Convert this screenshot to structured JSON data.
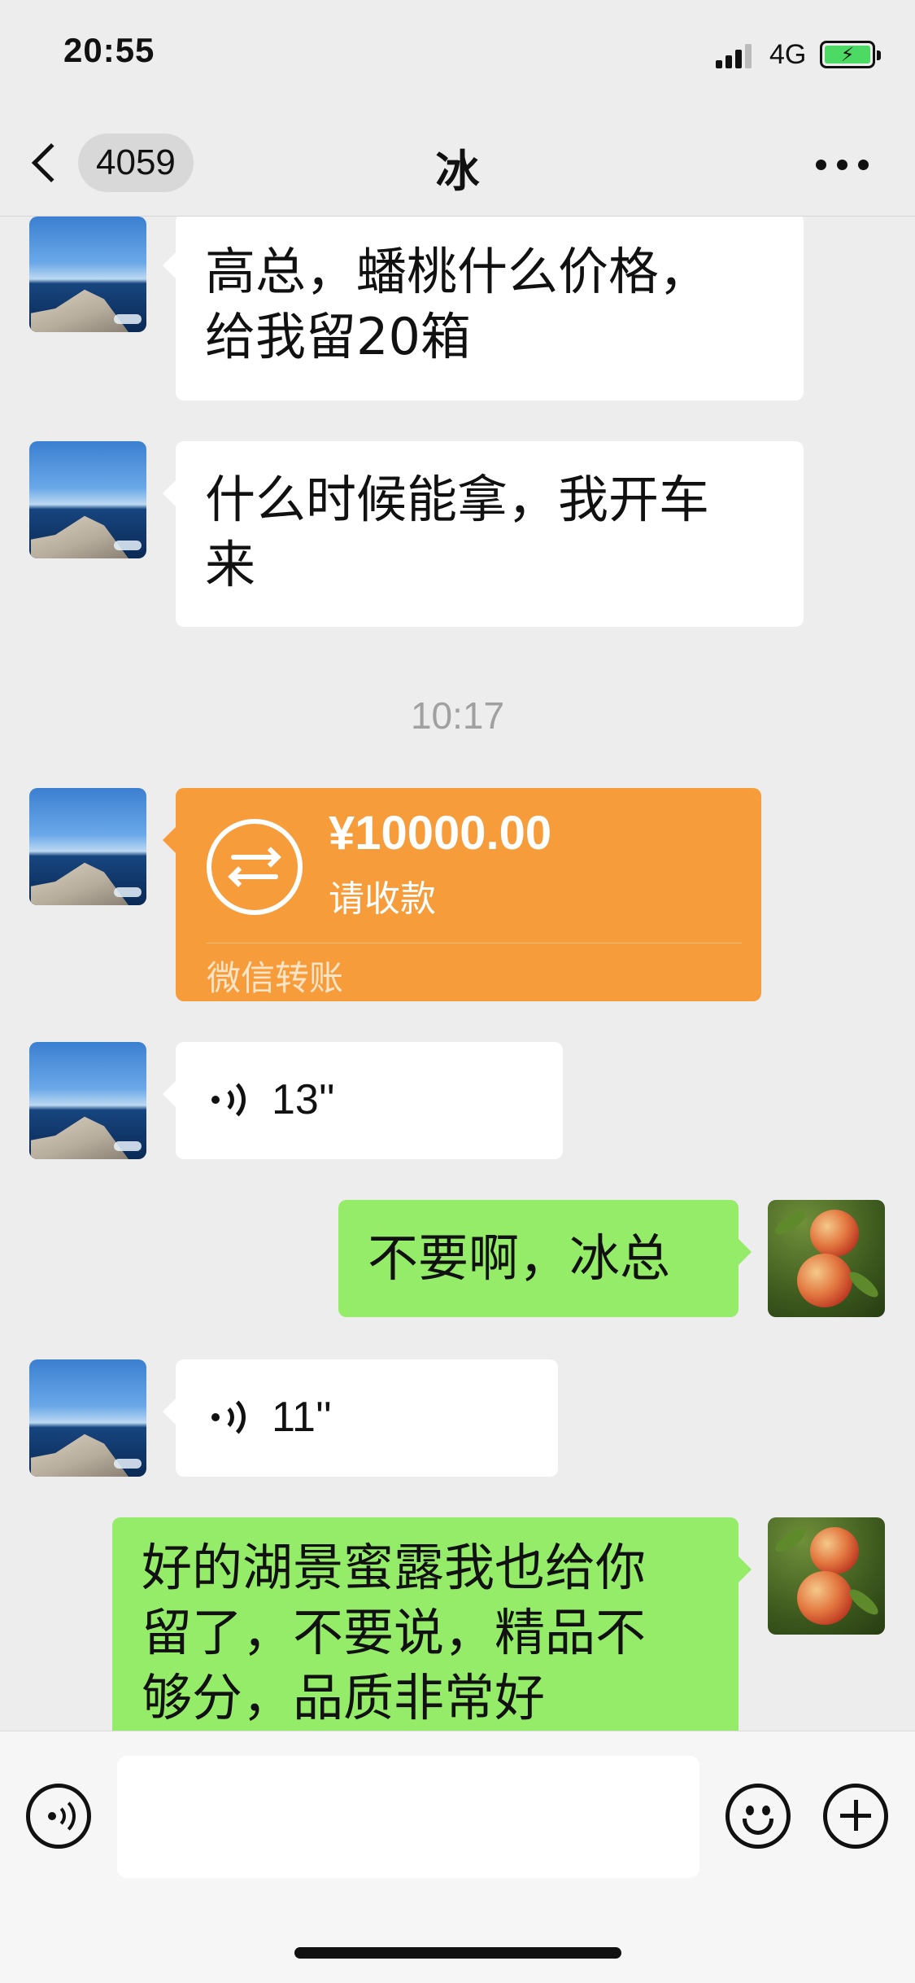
{
  "status_bar": {
    "time": "20:55",
    "network": "4G",
    "battery_charging": true
  },
  "nav": {
    "unread_count": "4059",
    "title": "冰"
  },
  "messages": [
    {
      "type": "text",
      "direction": "in",
      "lines": [
        "高总，蟠桃什么价格，",
        "给我留20箱"
      ]
    },
    {
      "type": "text",
      "direction": "in",
      "lines": [
        "什么时候能拿，我开车",
        "来"
      ]
    },
    {
      "type": "timestamp",
      "text": "10:17"
    },
    {
      "type": "transfer",
      "direction": "in",
      "amount": "¥10000.00",
      "status": "请收款",
      "footer": "微信转账"
    },
    {
      "type": "voice",
      "direction": "in",
      "duration": "13''"
    },
    {
      "type": "text",
      "direction": "out",
      "lines": [
        "不要啊，冰总"
      ]
    },
    {
      "type": "voice",
      "direction": "in",
      "duration": "11''"
    },
    {
      "type": "text",
      "direction": "out",
      "lines": [
        "好的湖景蜜露我也给你",
        "留了，不要说，精品不",
        "够分，品质非常好"
      ]
    }
  ],
  "colors": {
    "background": "#ededed",
    "incoming_bubble": "#ffffff",
    "outgoing_bubble": "#95ec69",
    "transfer_card": "#f79c3a",
    "timestamp_text": "#a0a0a0"
  },
  "icons": {
    "back": "chevron-left-icon",
    "more": "more-dots-icon",
    "voice": "voice-wave-icon",
    "emoji": "smiley-icon",
    "plus": "plus-circle-icon",
    "transfer": "transfer-arrows-icon"
  }
}
